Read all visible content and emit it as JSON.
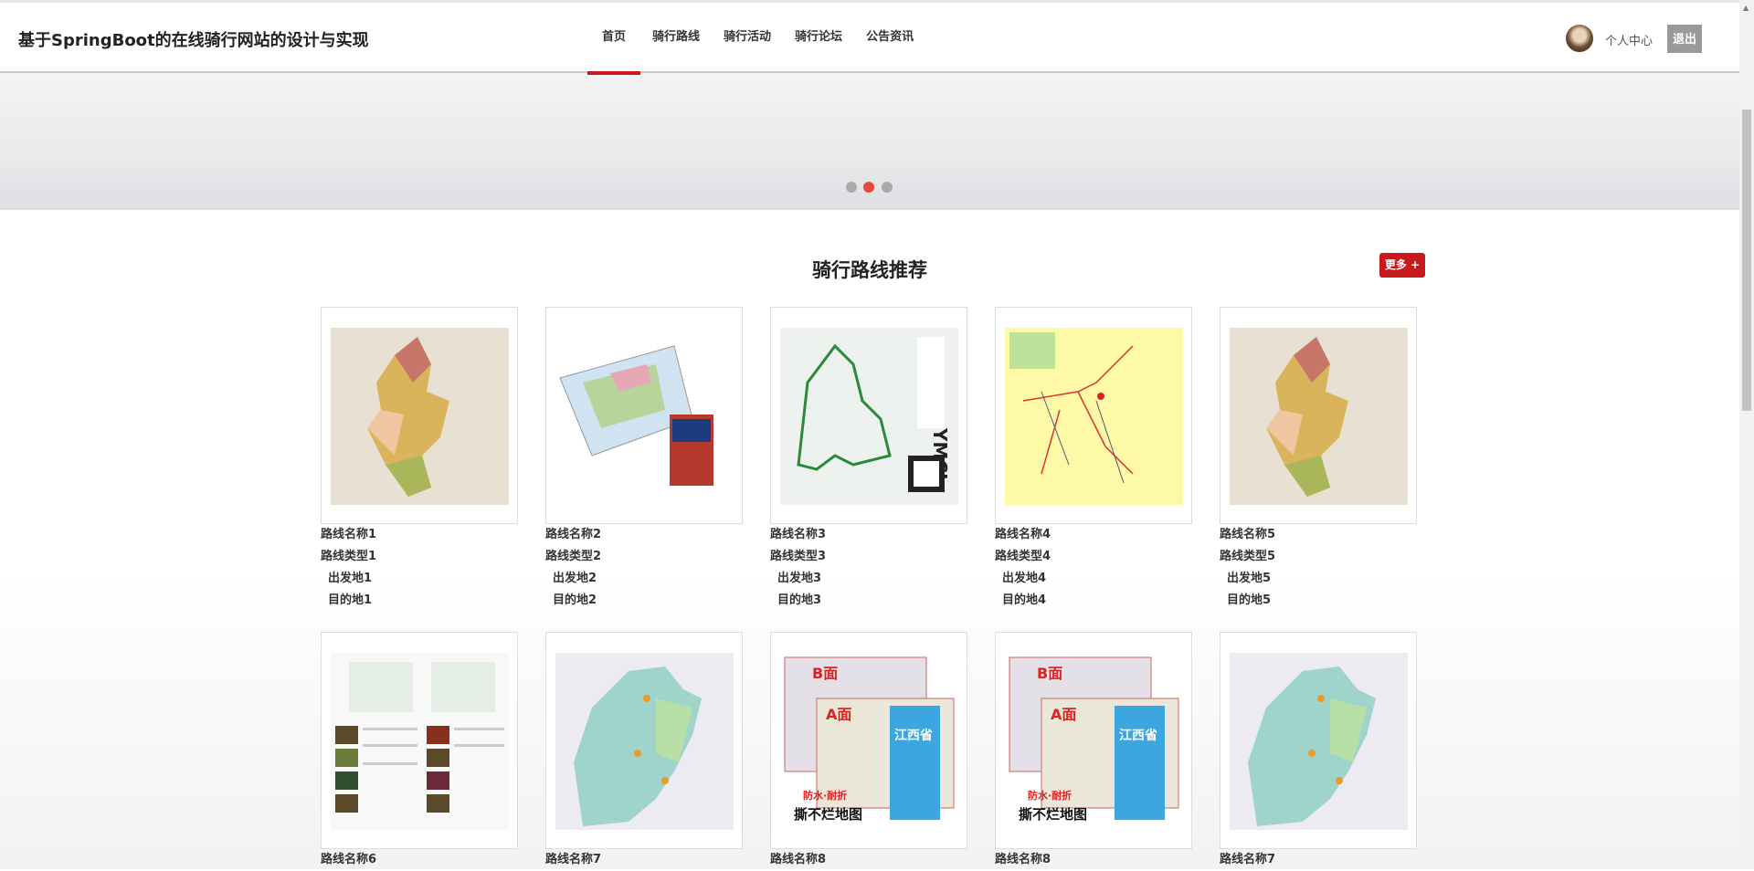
{
  "header": {
    "title": "基于SpringBoot的在线骑行网站的设计与实现",
    "nav": [
      "首页",
      "骑行路线",
      "骑行活动",
      "骑行论坛",
      "公告资讯"
    ],
    "user_center": "个人中心",
    "logout": "退出"
  },
  "banner": {
    "slides": 3,
    "active_slide": 2
  },
  "section": {
    "title": "骑行路线推荐",
    "more": "更多 +"
  },
  "routes": [
    {
      "name": "路线名称1",
      "type": "路线类型1",
      "from": "出发地1",
      "to": "目的地1",
      "image": "beige"
    },
    {
      "name": "路线名称2",
      "type": "路线类型2",
      "from": "出发地2",
      "to": "目的地2",
      "image": "paper"
    },
    {
      "name": "路线名称3",
      "type": "路线类型3",
      "from": "出发地3",
      "to": "目的地3",
      "image": "route"
    },
    {
      "name": "路线名称4",
      "type": "路线类型4",
      "from": "出发地4",
      "to": "目的地4",
      "image": "yellow"
    },
    {
      "name": "路线名称5",
      "type": "路线类型5",
      "from": "出发地5",
      "to": "目的地5",
      "image": "beige"
    },
    {
      "name": "路线名称6",
      "image": "doc"
    },
    {
      "name": "路线名称7",
      "image": "teal"
    },
    {
      "name": "路线名称8",
      "image": "jiangxi"
    },
    {
      "name": "路线名称8",
      "image": "jiangxi"
    },
    {
      "name": "路线名称7",
      "image": "teal"
    }
  ]
}
